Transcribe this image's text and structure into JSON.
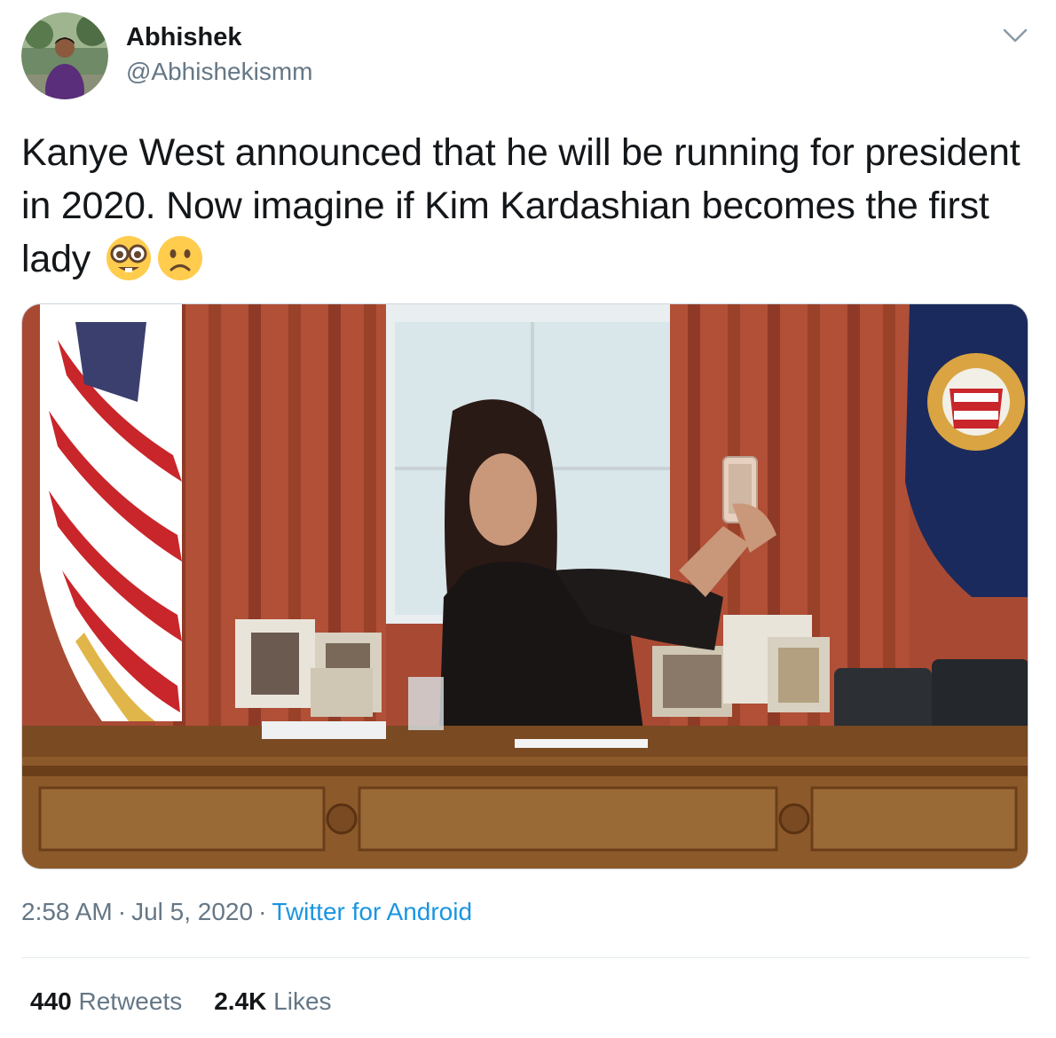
{
  "author": {
    "display_name": "Abhishek",
    "handle": "@Abhishekismm"
  },
  "tweet": {
    "text": "Kanye West announced that he will be running for president in 2020. Now imagine if Kim Kardashian becomes the first lady",
    "emojis": [
      "nerd-face-emoji",
      "slightly-frowning-face-emoji"
    ]
  },
  "meta": {
    "time": "2:58 AM",
    "separator": "·",
    "date": "Jul 5, 2020",
    "source": "Twitter for Android"
  },
  "stats": {
    "retweets_count": "440",
    "retweets_label": "Retweets",
    "likes_count": "2.4K",
    "likes_label": "Likes"
  },
  "colors": {
    "text": "#14171a",
    "secondary": "#657786",
    "link": "#1b95e0",
    "divider": "#e6ecf0"
  }
}
